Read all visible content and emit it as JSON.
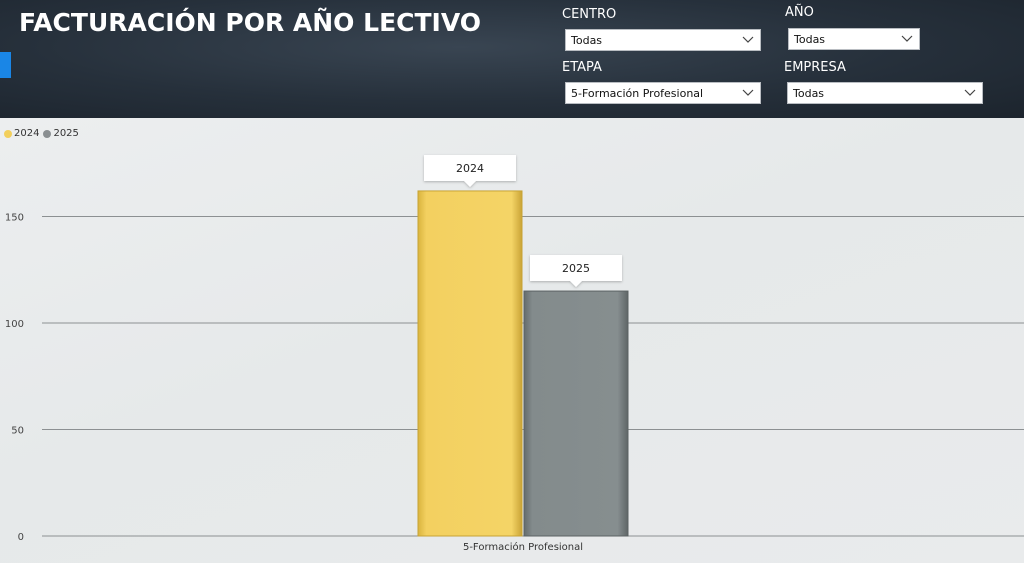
{
  "header": {
    "title": "FACTURACIÓN POR AÑO LECTIVO",
    "filters": {
      "centro": {
        "label": "CENTRO",
        "value": "Todas"
      },
      "anio": {
        "label": "AÑO",
        "value": "Todas"
      },
      "etapa": {
        "label": "ETAPA",
        "value": "5-Formación Profesional"
      },
      "empresa": {
        "label": "EMPRESA",
        "value": "Todas"
      }
    }
  },
  "colors": {
    "header_bg": "#26303b",
    "accent": "#1a86e6",
    "series_2024": "#f2cf5c",
    "series_2025": "#7f8788"
  },
  "legend": [
    {
      "name": "2024",
      "color": "#f2cf5c"
    },
    {
      "name": "2025",
      "color": "#8a8f91"
    }
  ],
  "chart_data": {
    "type": "bar",
    "categories": [
      "5-Formación Profesional"
    ],
    "series": [
      {
        "name": "2024",
        "values": [
          162
        ]
      },
      {
        "name": "2025",
        "values": [
          115
        ]
      }
    ],
    "data_labels": [
      "2024",
      "2025"
    ],
    "yticks": [
      "0",
      "50",
      "100",
      "150"
    ],
    "ylim": [
      0,
      170
    ],
    "grid": true,
    "legend_position": "top-left"
  }
}
